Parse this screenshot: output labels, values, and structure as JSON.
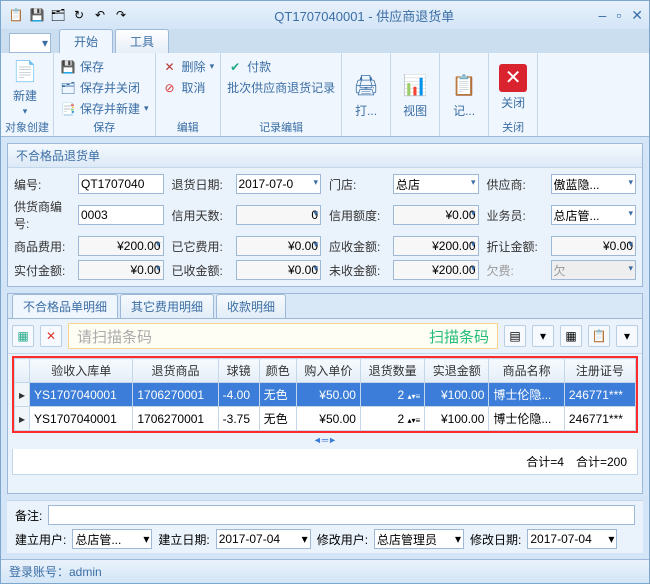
{
  "window": {
    "title": "QT1707040001 - 供应商退货单"
  },
  "menu": {
    "tab1": "开始",
    "tab2": "工具"
  },
  "ribbon": {
    "new": "新建",
    "group_create": "对象创建",
    "save": "保存",
    "save_close": "保存并关闭",
    "save_new": "保存并新建",
    "group_save": "保存",
    "delete": "删除",
    "cancel": "取消",
    "group_edit": "编辑",
    "pay": "付款",
    "batch": "批次供应商退货记录",
    "group_rec": "记录编辑",
    "print": "打...",
    "view": "视图",
    "log": "记...",
    "close": "关闭",
    "group_close": "关闭"
  },
  "panel_title": "不合格品退货单",
  "fields": {
    "doc_no_l": "编号:",
    "doc_no": "QT1707040",
    "return_date_l": "退货日期:",
    "return_date": "2017-07-0",
    "store_l": "门店:",
    "store": "总店",
    "supplier_l": "供应商:",
    "supplier": "傲蓝隐...",
    "supplier_no_l": "供货商编号:",
    "supplier_no": "0003",
    "credit_days_l": "信用天数:",
    "credit_days": "0",
    "credit_amt_l": "信用额度:",
    "credit_amt": "¥0.00",
    "clerk_l": "业务员:",
    "clerk": "总店管...",
    "goods_fee_l": "商品费用:",
    "goods_fee": "¥200.00",
    "other_fee_l": "已它费用:",
    "other_fee": "¥0.00",
    "recv_amt_l": "应收金额:",
    "recv_amt": "¥200.00",
    "disc_amt_l": "折让金额:",
    "disc_amt": "¥0.00",
    "pay_amt_l": "实付金额:",
    "pay_amt": "¥0.00",
    "recvd_amt_l": "已收金额:",
    "recvd_amt": "¥0.00",
    "unrecv_l": "未收金额:",
    "unrecv": "¥200.00",
    "owe_l": "欠费:",
    "owe": "欠"
  },
  "tabs": {
    "t1": "不合格品单明细",
    "t2": "其它费用明细",
    "t3": "收款明细"
  },
  "search": {
    "placeholder": "请扫描条码",
    "hint": "扫描条码"
  },
  "grid": {
    "headers": [
      "验收入库单",
      "退货商品",
      "球镜",
      "颜色",
      "购入单价",
      "退货数量",
      "实退金额",
      "商品名称",
      "注册证号"
    ],
    "rows": [
      [
        "YS1707040001",
        "1706270001",
        "-4.00",
        "无色",
        "¥50.00",
        "2",
        "¥100.00",
        "博士伦隐...",
        "246771***"
      ],
      [
        "YS1707040001",
        "1706270001",
        "-3.75",
        "无色",
        "¥50.00",
        "2",
        "¥100.00",
        "博士伦隐...",
        "246771***"
      ]
    ],
    "sum1": "合计=4",
    "sum2": "合计=200"
  },
  "footer": {
    "remark_l": "备注:",
    "cu_l": "建立用户:",
    "cu": "总店管...",
    "cd_l": "建立日期:",
    "cd": "2017-07-04",
    "mu_l": "修改用户:",
    "mu": "总店管理员",
    "md_l": "修改日期:",
    "md": "2017-07-04"
  },
  "status": "登录账号：admin"
}
